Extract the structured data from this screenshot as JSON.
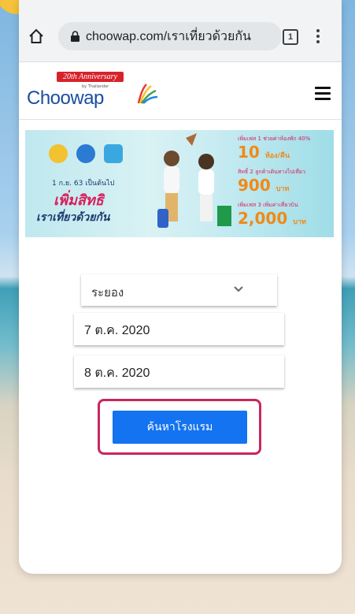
{
  "browser": {
    "url": "choowap.com/เราเที่ยวด้วยกัน",
    "tab_count": "1"
  },
  "site": {
    "logo_ribbon": "20th Anniversary",
    "logo_sub": "by Thailander",
    "logo_text": "Choowap"
  },
  "banner": {
    "date_text": "1 ก.ย. 63 เป็นต้นไป",
    "headline": "เพิ่มสิทธิ",
    "subheadline": "เราเที่ยวด้วยกัน",
    "offers": [
      {
        "label": "เพิ่มเฟส 1 ช่วยค่าห้องพัก 40%",
        "value": "10",
        "unit": "ห้อง/คืน"
      },
      {
        "label": "สิทธิ์ 2 ลูกค้าเดินทางไปเที่ยว",
        "value": "900",
        "unit": "บาท"
      },
      {
        "label": "เพิ่มเฟส 3 เพิ่มค่าเที่ยวบิน",
        "value": "2,000",
        "unit": "บาท"
      }
    ]
  },
  "form": {
    "province": "ระยอง",
    "checkin": "7 ต.ค. 2020",
    "checkout": "8 ต.ค. 2020",
    "search_label": "ค้นหาโรงแรม"
  },
  "colors": {
    "accent_button": "#1473f0",
    "highlight": "#c8285a",
    "brand": "#1a4e9f"
  }
}
